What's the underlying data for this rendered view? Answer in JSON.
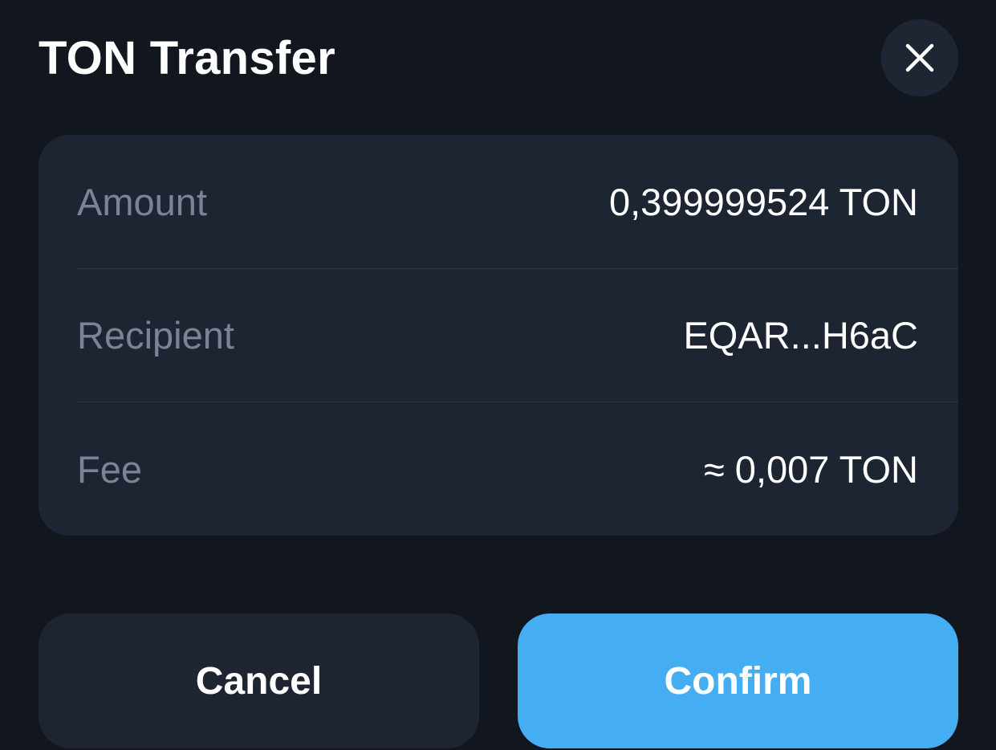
{
  "header": {
    "title": "TON Transfer",
    "close_icon": "close-icon"
  },
  "details": {
    "rows": [
      {
        "label": "Amount",
        "value": "0,399999524 TON"
      },
      {
        "label": "Recipient",
        "value": "EQAR...H6aC"
      },
      {
        "label": "Fee",
        "value": "≈ 0,007 TON"
      }
    ]
  },
  "actions": {
    "cancel_label": "Cancel",
    "confirm_label": "Confirm"
  },
  "colors": {
    "background": "#12161f",
    "card": "#1e2532",
    "accent": "#45aef2",
    "label_text": "#7a8494"
  }
}
